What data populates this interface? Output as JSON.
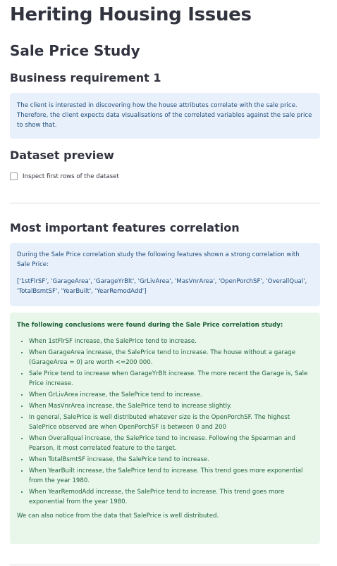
{
  "title": "Heriting Housing Issues",
  "sale_study": "Sale Price Study",
  "business_req": {
    "heading": "Business requirement 1",
    "text": "The client is interested in discovering how the house attributes correlate with the sale price. Therefore, the client expects data visualisations of the correlated variables against the sale price to show that."
  },
  "dataset_preview": {
    "heading": "Dataset preview",
    "checkbox_label": "Inspect first rows of the dataset"
  },
  "correlation": {
    "heading": "Most important features correlation",
    "intro": "During the Sale Price correlation study the following features shown a strong correlation with Sale Price:",
    "features": "['1stFlrSF', 'GarageArea', 'GarageYrBlt', 'GrLivArea', 'MasVnrArea', 'OpenPorchSF', 'OverallQual', 'TotalBsmtSF', 'YearBuilt', 'YearRemodAdd']"
  },
  "conclusions": {
    "lead": "The following conclusions were found during the Sale Price correlation study:",
    "items": [
      "When 1stFlrSF increase, the SalePrice tend to increase.",
      "When GarageArea increase, the SalePrice tend to increase. The house without a garage (GarageArea = 0) are worth <=200 000.",
      "Sale Price tend to increase when GarageYrBlt increase. The more recent the Garage is, Sale Price increase.",
      "When GrLivArea increase, the SalePrice tend to increase.",
      "When MasVnrArea increase, the SalePrice tend to increase slightly.",
      "In general, SalePrice is well distributed whatever size is the OpenPorchSF. The highest SalePrice observed are when OpenPorchSF is between 0 and 200",
      "When Overallqual increase, the SalePrice tend to increase. Following the Spearman and Pearson, it most correlated feature to the target.",
      "When TotalBsmtSF increase, the SalePrice tend to increase.",
      "When YearBuilt increase, the SalePrice tend to increase. This trend goes more exponential from the year 1980.",
      "When YearRemodAdd increase, the SalePrice tend to increase. This trend goes more exponential from the year 1980."
    ],
    "tail": "We can also notice from the data that SalePrice is well distributed."
  }
}
